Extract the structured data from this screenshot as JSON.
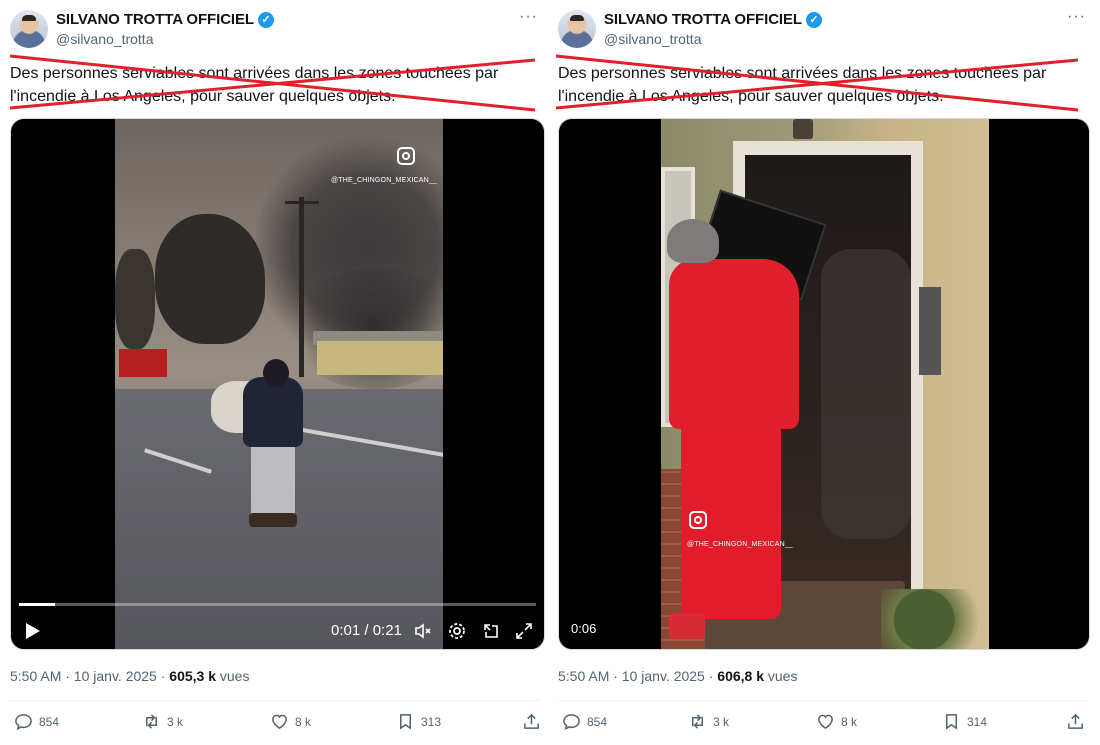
{
  "tweets": [
    {
      "author": {
        "name": "SILVANO TROTTA OFFICIEL",
        "handle": "@silvano_trotta",
        "verified_icon": "verified-badge-icon"
      },
      "more_label": "···",
      "text": "Des personnes serviables sont arrivées dans les zones touchées par l'incendie à Los Angeles, pour sauver quelques objets.",
      "video": {
        "watermark": "@THE_CHINGON_MEXICAN__",
        "time_display": "0:01 / 0:21",
        "progress": 0.07,
        "controls": [
          "play-icon",
          "mute-icon",
          "settings-icon",
          "dock-icon",
          "fullscreen-icon"
        ]
      },
      "meta": {
        "timestamp": "5:50 AM · 10 janv. 2025 · ",
        "views_count": "605,3 k",
        "views_label": " vues"
      },
      "actions": {
        "replies": "854",
        "reposts": "3 k",
        "likes": "8 k",
        "bookmarks": "313"
      }
    },
    {
      "author": {
        "name": "SILVANO TROTTA OFFICIEL",
        "handle": "@silvano_trotta",
        "verified_icon": "verified-badge-icon"
      },
      "more_label": "···",
      "text": "Des personnes serviables sont arrivées dans les zones touchées par l'incendie à Los Angeles, pour sauver quelques objets.",
      "video": {
        "watermark": "@THE_CHINGON_MEXICAN__",
        "time_badge": "0:06"
      },
      "meta": {
        "timestamp": "5:50 AM · 10 janv. 2025 · ",
        "views_count": "606,8 k",
        "views_label": " vues"
      },
      "actions": {
        "replies": "854",
        "reposts": "3 k",
        "likes": "8 k",
        "bookmarks": "314"
      }
    }
  ],
  "colors": {
    "accent": "#1d9bf0",
    "strike": "#e0202b",
    "muted": "#536471",
    "text": "#0f1419"
  }
}
